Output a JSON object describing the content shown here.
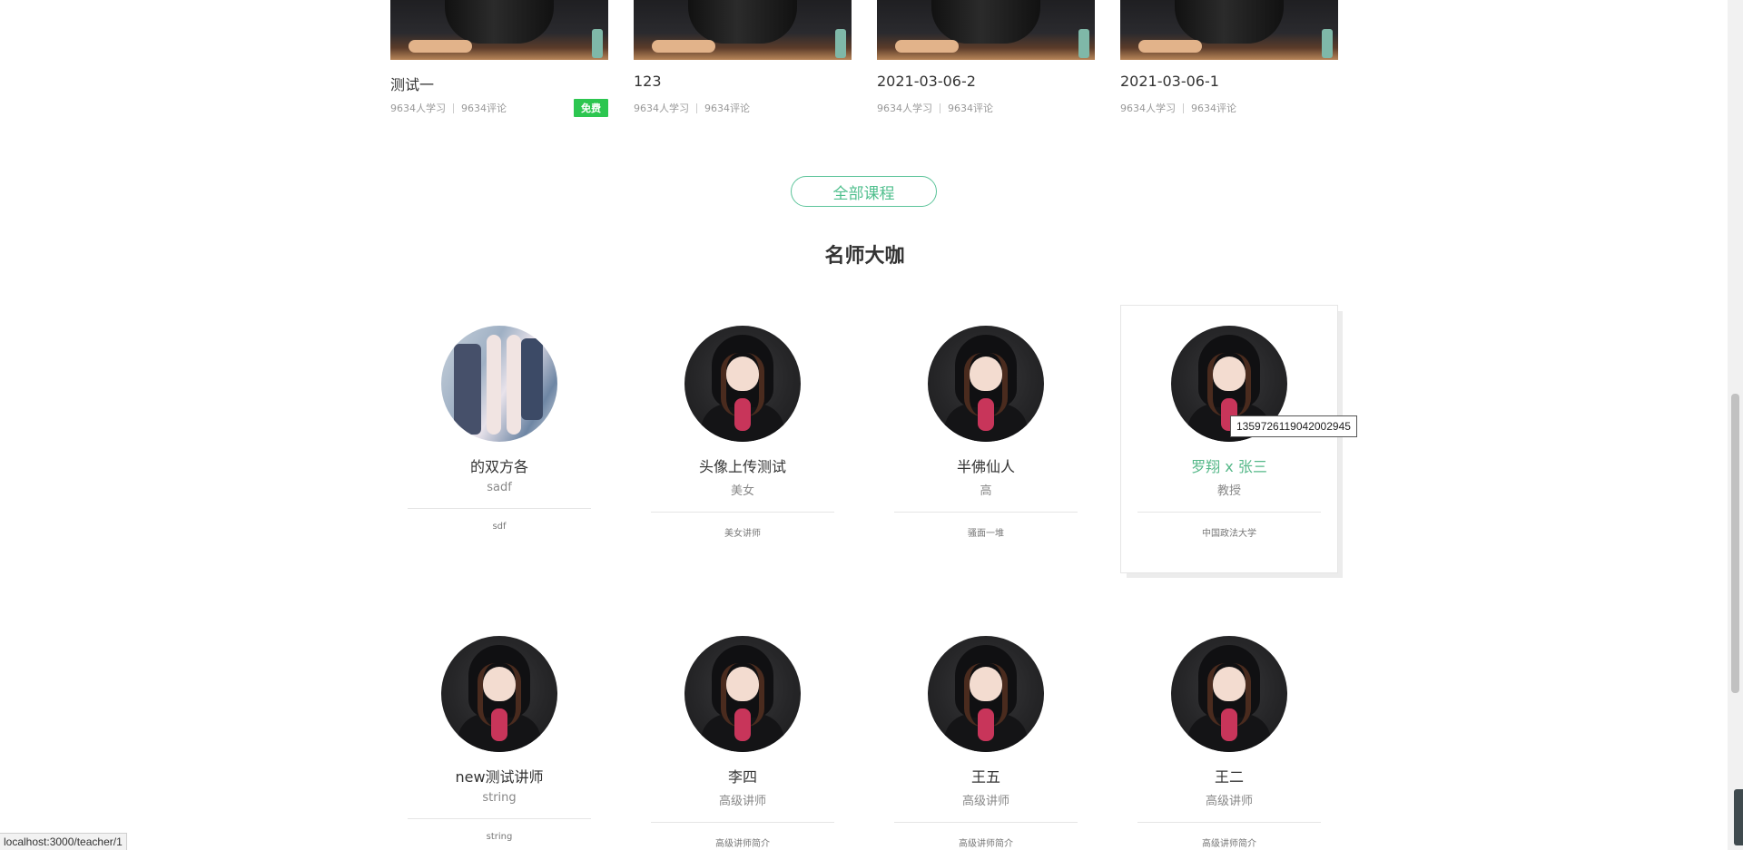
{
  "courses": [
    {
      "title": "测试一",
      "students": "9634人学习",
      "comments": "9634评论",
      "badge": "免费"
    },
    {
      "title": "123",
      "students": "9634人学习",
      "comments": "9634评论",
      "badge": ""
    },
    {
      "title": "2021-03-06-2",
      "students": "9634人学习",
      "comments": "9634评论",
      "badge": ""
    },
    {
      "title": "2021-03-06-1",
      "students": "9634人学习",
      "comments": "9634评论",
      "badge": ""
    }
  ],
  "all_courses_button": "全部课程",
  "teachers_section_title": "名师大咖",
  "teachers": [
    {
      "name": "的双方各",
      "title": "sadf",
      "intro": "sdf"
    },
    {
      "name": "头像上传测试",
      "title": "美女",
      "intro": "美女讲师"
    },
    {
      "name": "半佛仙人",
      "title": "高",
      "intro": "骚面一堆"
    },
    {
      "name": "罗翔 x 张三",
      "title": "教授",
      "intro": "中国政法大学"
    },
    {
      "name": "new测试讲师",
      "title": "string",
      "intro": "string"
    },
    {
      "name": "李四",
      "title": "高级讲师",
      "intro": "高级讲师简介"
    },
    {
      "name": "王五",
      "title": "高级讲师",
      "intro": "高级讲师简介"
    },
    {
      "name": "王二",
      "title": "高级讲师",
      "intro": "高级讲师简介"
    }
  ],
  "tooltip": "1359726119042002945",
  "status_bar_url": "localhost:3000/teacher/1",
  "colors": {
    "accent": "#56b889",
    "free_badge": "#2cc650",
    "button_border": "#5cc49a"
  }
}
